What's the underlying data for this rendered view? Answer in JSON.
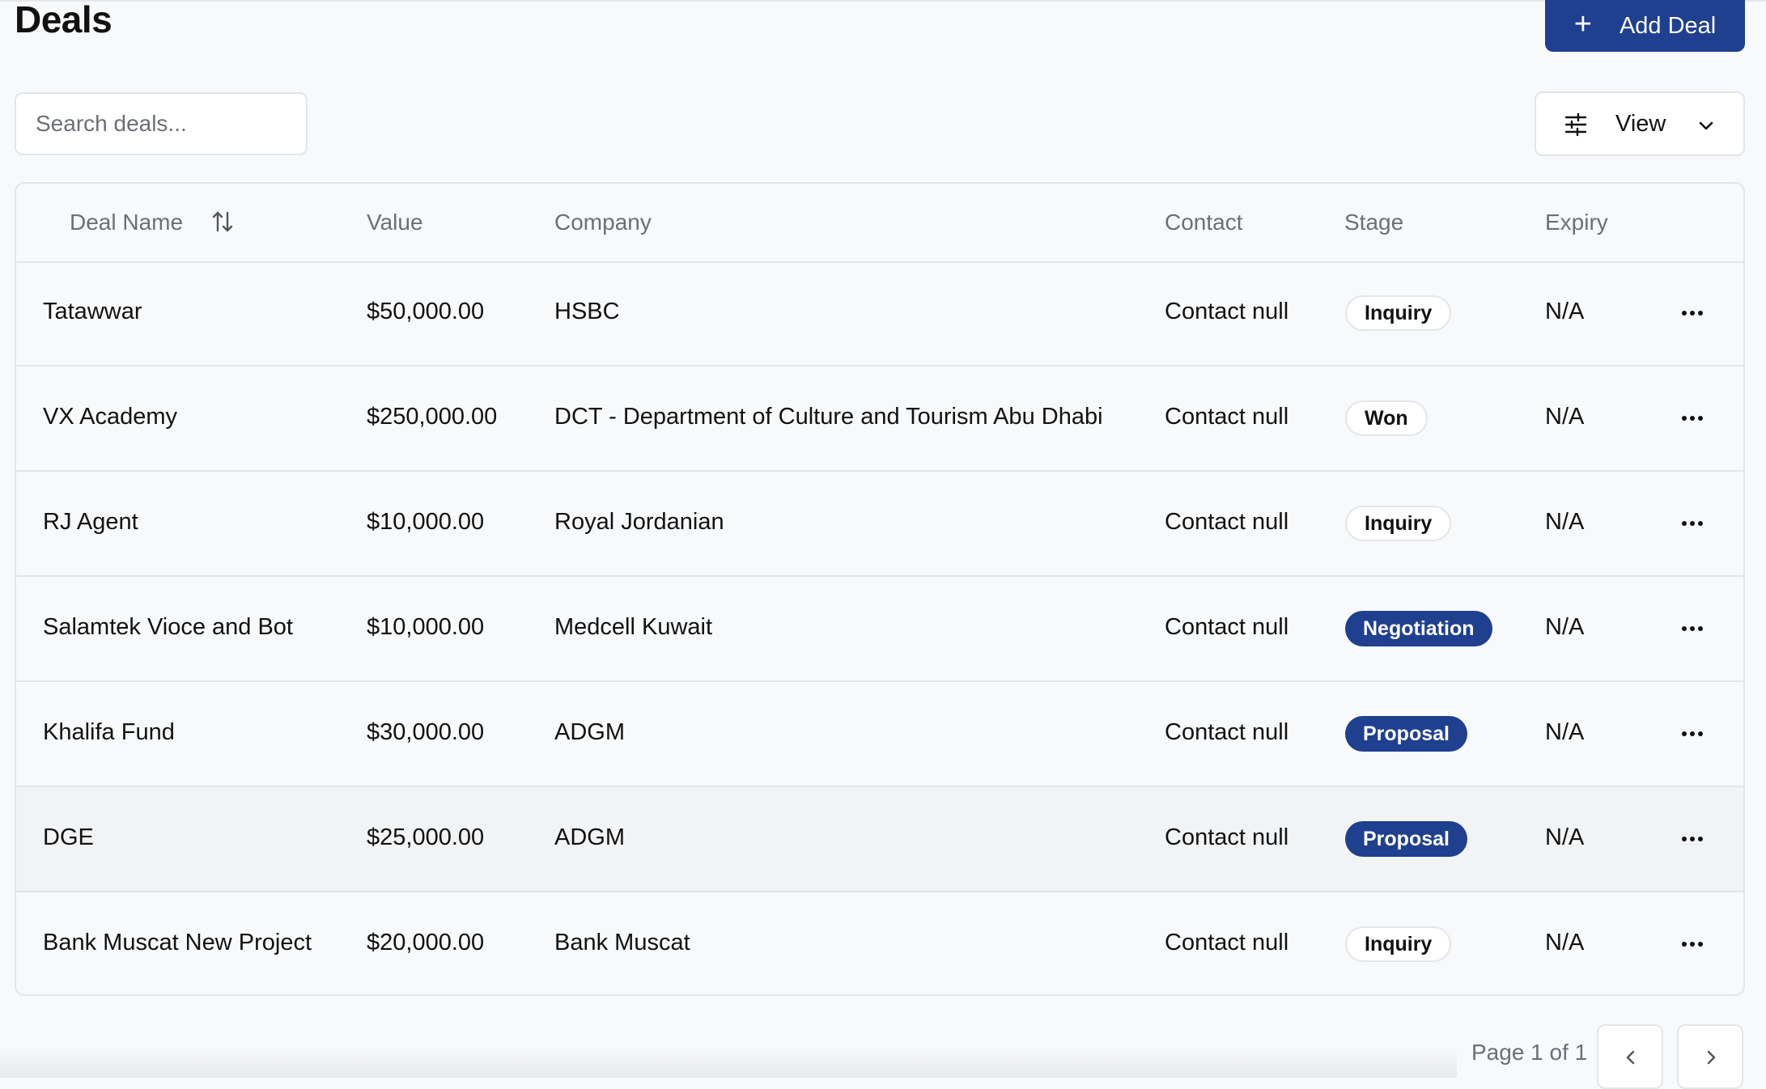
{
  "header": {
    "title": "Deals",
    "add_button_label": "Add Deal"
  },
  "toolbar": {
    "search_placeholder": "Search deals...",
    "view_label": "View"
  },
  "table": {
    "columns": [
      "Deal Name",
      "Value",
      "Company",
      "Contact",
      "Stage",
      "Expiry"
    ],
    "rows": [
      {
        "name": "Tatawwar",
        "value": "$50,000.00",
        "company": "HSBC",
        "contact": "Contact null",
        "stage": "Inquiry",
        "expiry": "N/A"
      },
      {
        "name": "VX Academy",
        "value": "$250,000.00",
        "company": "DCT - Department of Culture and Tourism Abu Dhabi",
        "contact": "Contact null",
        "stage": "Won",
        "expiry": "N/A"
      },
      {
        "name": "RJ Agent",
        "value": "$10,000.00",
        "company": "Royal Jordanian",
        "contact": "Contact null",
        "stage": "Inquiry",
        "expiry": "N/A"
      },
      {
        "name": "Salamtek Vioce and Bot",
        "value": "$10,000.00",
        "company": "Medcell Kuwait",
        "contact": "Contact null",
        "stage": "Negotiation",
        "expiry": "N/A"
      },
      {
        "name": "Khalifa Fund",
        "value": "$30,000.00",
        "company": "ADGM",
        "contact": "Contact null",
        "stage": "Proposal",
        "expiry": "N/A"
      },
      {
        "name": "DGE",
        "value": "$25,000.00",
        "company": "ADGM",
        "contact": "Contact null",
        "stage": "Proposal",
        "expiry": "N/A"
      },
      {
        "name": "Bank Muscat New Project",
        "value": "$20,000.00",
        "company": "Bank Muscat",
        "contact": "Contact null",
        "stage": "Inquiry",
        "expiry": "N/A"
      }
    ]
  },
  "pagination": {
    "label": "Page 1 of 1"
  },
  "colors": {
    "primary": "#1f3f8f",
    "border": "#e3e5e9",
    "muted_text": "#6b6f76",
    "background": "#f8f9fb"
  },
  "icons": {
    "add": "plus-icon",
    "view": "sliders-icon",
    "dropdown": "chevron-down-icon",
    "sort": "sort-arrows-icon",
    "row_actions": "more-horizontal-icon",
    "prev": "chevron-left-icon",
    "next": "chevron-right-icon"
  }
}
